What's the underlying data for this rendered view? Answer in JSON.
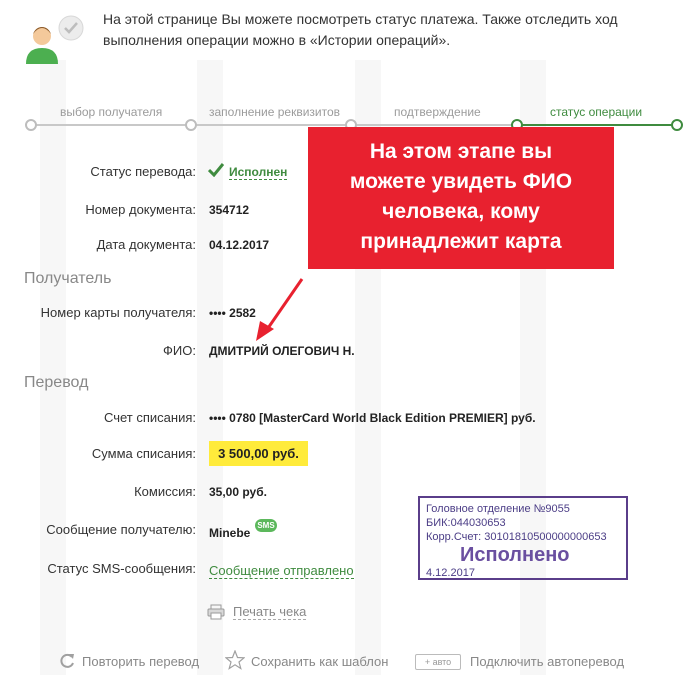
{
  "header": {
    "intro_line1": "На этой странице Вы можете посмотреть статус платежа. Также отследить ход",
    "intro_line2": "выполнения операции можно в «Истории операций»."
  },
  "steps": [
    {
      "label": "выбор получателя",
      "active": false
    },
    {
      "label": "заполнение реквизитов",
      "active": false
    },
    {
      "label": "подтверждение",
      "active": false
    },
    {
      "label": "статус операции",
      "active": true
    }
  ],
  "details": {
    "status_label": "Статус перевода:",
    "status_value": "Исполнен",
    "doc_number_label": "Номер документа:",
    "doc_number_value": "354712",
    "doc_date_label": "Дата документа:",
    "doc_date_value": "04.12.2017"
  },
  "recipient": {
    "section_title": "Получатель",
    "card_label": "Номер карты получателя:",
    "card_value": "•••• 2582",
    "name_label": "ФИО:",
    "name_value": "ДМИТРИЙ ОЛЕГОВИЧ Н."
  },
  "transfer": {
    "section_title": "Перевод",
    "account_label": "Счет списания:",
    "account_value": "•••• 0780  [MasterCard World Black Edition PREMIER]  руб.",
    "amount_label": "Сумма списания:",
    "amount_value": "3 500,00  руб.",
    "fee_label": "Комиссия:",
    "fee_value": "35,00 руб.",
    "message_label": "Сообщение получателю:",
    "message_value": "Minebe",
    "sms_badge": "SMS",
    "sms_status_label": "Статус SMS-сообщения:",
    "sms_status_value": "Сообщение отправлено"
  },
  "callout": {
    "line1": "На этом этапе вы",
    "line2": "можете увидеть ФИО",
    "line3": "человека, кому",
    "line4": "принадлежит карта"
  },
  "stamp": {
    "line1": "Головное отделение №9055",
    "line2": "БИК:044030653",
    "line3": "Корр.Счет: 30101810500000000653",
    "status": "Исполнено",
    "date": "4.12.2017"
  },
  "actions": {
    "print": "Печать чека",
    "repeat": "Повторить перевод",
    "save_template": "Сохранить как шаблон",
    "auto_badge": "+ авто",
    "auto_transfer": "Подключить автоперевод"
  },
  "colors": {
    "accent_green": "#3f8b3f",
    "callout_red": "#e8212f",
    "highlight_yellow": "#ffeb3b",
    "stamp_purple": "#5a3d8a"
  }
}
